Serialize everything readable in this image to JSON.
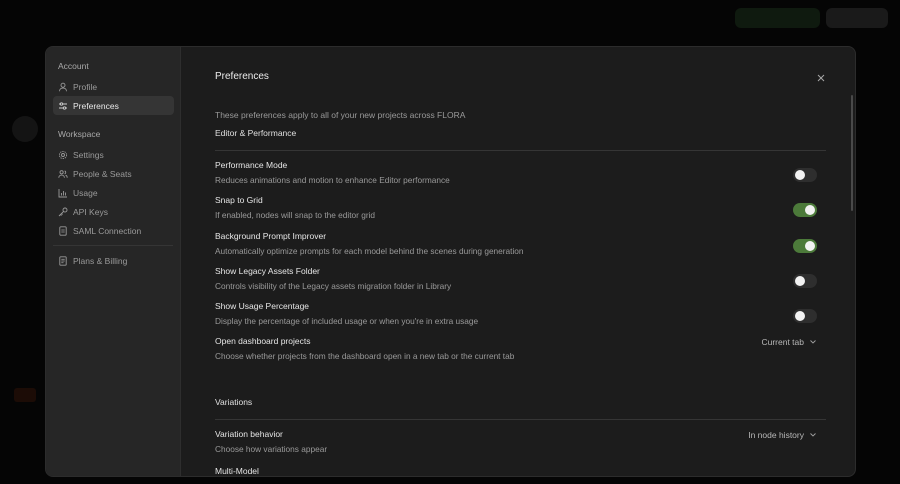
{
  "sidebar": {
    "account_label": "Account",
    "account_items": [
      {
        "label": "Profile",
        "icon": "user-icon"
      },
      {
        "label": "Preferences",
        "icon": "sliders-icon",
        "active": true
      }
    ],
    "workspace_label": "Workspace",
    "workspace_items": [
      {
        "label": "Settings",
        "icon": "gear-icon"
      },
      {
        "label": "People & Seats",
        "icon": "people-icon"
      },
      {
        "label": "Usage",
        "icon": "bar-chart-icon"
      },
      {
        "label": "API Keys",
        "icon": "key-icon"
      },
      {
        "label": "SAML Connection",
        "icon": "document-icon"
      }
    ],
    "billing_item": {
      "label": "Plans & Billing",
      "icon": "receipt-icon"
    }
  },
  "content": {
    "title": "Preferences",
    "intro": "These preferences apply to all of your new projects across FLORA",
    "editor_heading": "Editor & Performance",
    "settings": [
      {
        "title": "Performance Mode",
        "desc": "Reduces animations and motion to enhance Editor performance",
        "type": "toggle",
        "on": false
      },
      {
        "title": "Snap to Grid",
        "desc": "If enabled, nodes will snap to the editor grid",
        "type": "toggle",
        "on": true
      },
      {
        "title": "Background Prompt Improver",
        "desc": "Automatically optimize prompts for each model behind the scenes during generation",
        "type": "toggle",
        "on": true
      },
      {
        "title": "Show Legacy Assets Folder",
        "desc": "Controls visibility of the Legacy assets migration folder in Library",
        "type": "toggle",
        "on": false
      },
      {
        "title": "Show Usage Percentage",
        "desc": "Display the percentage of included usage or when you're in extra usage",
        "type": "toggle",
        "on": false
      },
      {
        "title": "Open dashboard projects",
        "desc": "Choose whether projects from the dashboard open in a new tab or the current tab",
        "type": "select",
        "value": "Current tab"
      }
    ],
    "variations_heading": "Variations",
    "variation": {
      "title": "Variation behavior",
      "desc": "Choose how variations appear",
      "value": "In node history"
    },
    "multi_model_heading": "Multi-Model"
  },
  "colors": {
    "toggle_on": "#4c7a3a",
    "toggle_off": "#2e2e2e",
    "modal_bg": "#1c1c1c",
    "sidebar_bg": "#262626"
  }
}
